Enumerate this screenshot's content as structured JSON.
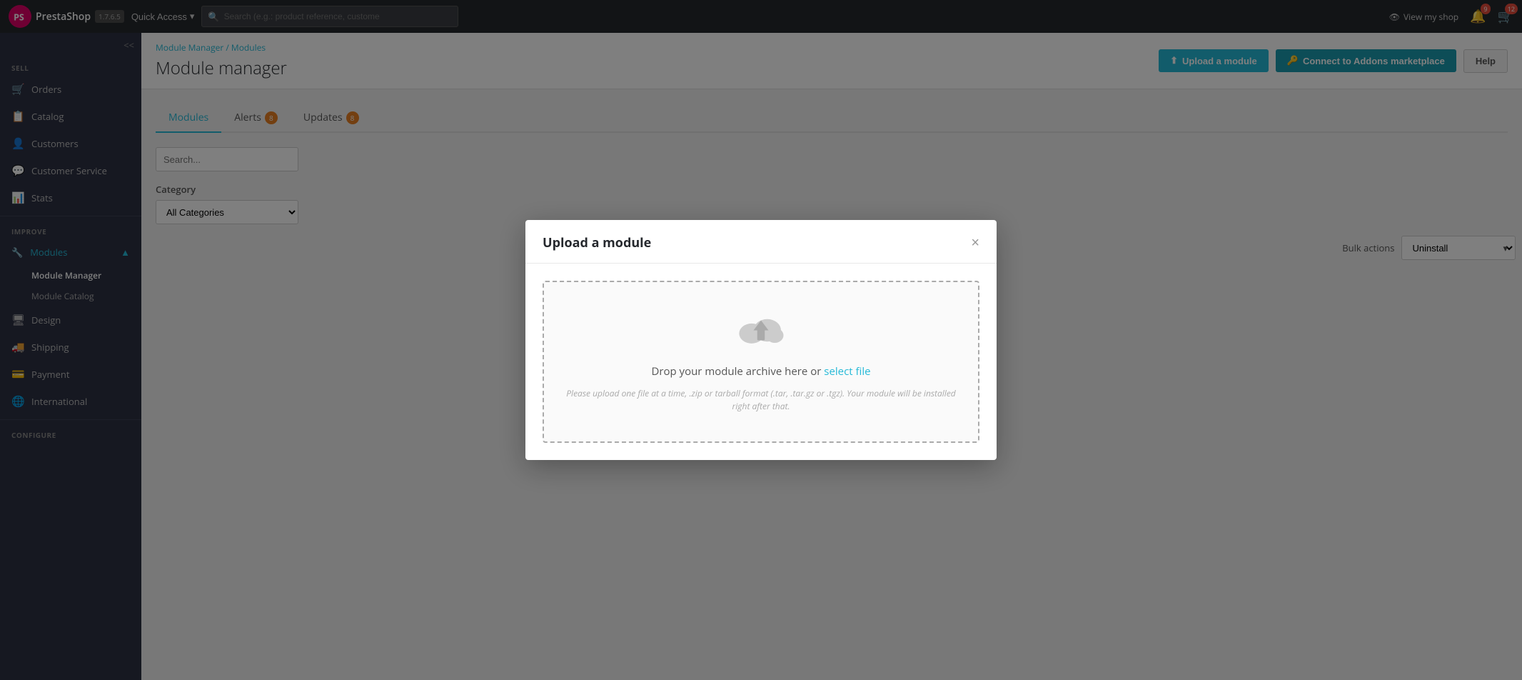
{
  "topnav": {
    "logo_text": "PrestaShop",
    "version": "1.7.6.5",
    "quick_access": "Quick Access",
    "search_placeholder": "Search (e.g.: product reference, custome",
    "view_shop": "View my shop",
    "notifications_count": "9",
    "orders_count": "12"
  },
  "sidebar": {
    "collapse_label": "<<",
    "sections": {
      "sell": "SELL",
      "improve": "IMPROVE",
      "configure": "CONFIGURE"
    },
    "sell_items": [
      {
        "label": "Orders",
        "icon": "🛒"
      },
      {
        "label": "Catalog",
        "icon": "📋"
      },
      {
        "label": "Customers",
        "icon": "👤"
      },
      {
        "label": "Customer Service",
        "icon": "💬"
      },
      {
        "label": "Stats",
        "icon": "📊"
      }
    ],
    "improve_items": [
      {
        "label": "Modules",
        "icon": "🔧",
        "active": true
      },
      {
        "label": "Design",
        "icon": "🖥"
      },
      {
        "label": "Shipping",
        "icon": "🚚"
      },
      {
        "label": "Payment",
        "icon": "💳"
      },
      {
        "label": "International",
        "icon": "🌐"
      }
    ],
    "modules_sub": [
      {
        "label": "Module Manager",
        "active": true
      },
      {
        "label": "Module Catalog"
      }
    ]
  },
  "breadcrumb": {
    "parent": "Module Manager",
    "separator": "/",
    "current": "Modules"
  },
  "page": {
    "title": "Module manager"
  },
  "header_buttons": {
    "upload": "Upload a module",
    "connect": "Connect to Addons marketplace",
    "help": "Help"
  },
  "tabs": [
    {
      "label": "Modules",
      "active": true,
      "badge": null
    },
    {
      "label": "Alerts",
      "active": false,
      "badge": "8"
    },
    {
      "label": "Updates",
      "active": false,
      "badge": "8"
    }
  ],
  "filters": {
    "search_placeholder": "Search...",
    "category_label": "Category",
    "category_default": "All Categories",
    "bulk_label": "Bulk actions",
    "bulk_default": "Uninstall"
  },
  "modal": {
    "title": "Upload a module",
    "close_label": "×",
    "drop_text": "Drop your module archive here or",
    "select_file_link": "select file",
    "hint": "Please upload one file at a time, .zip or tarball format (.tar, .tar.gz or .tgz). Your module will be installed right after that."
  }
}
